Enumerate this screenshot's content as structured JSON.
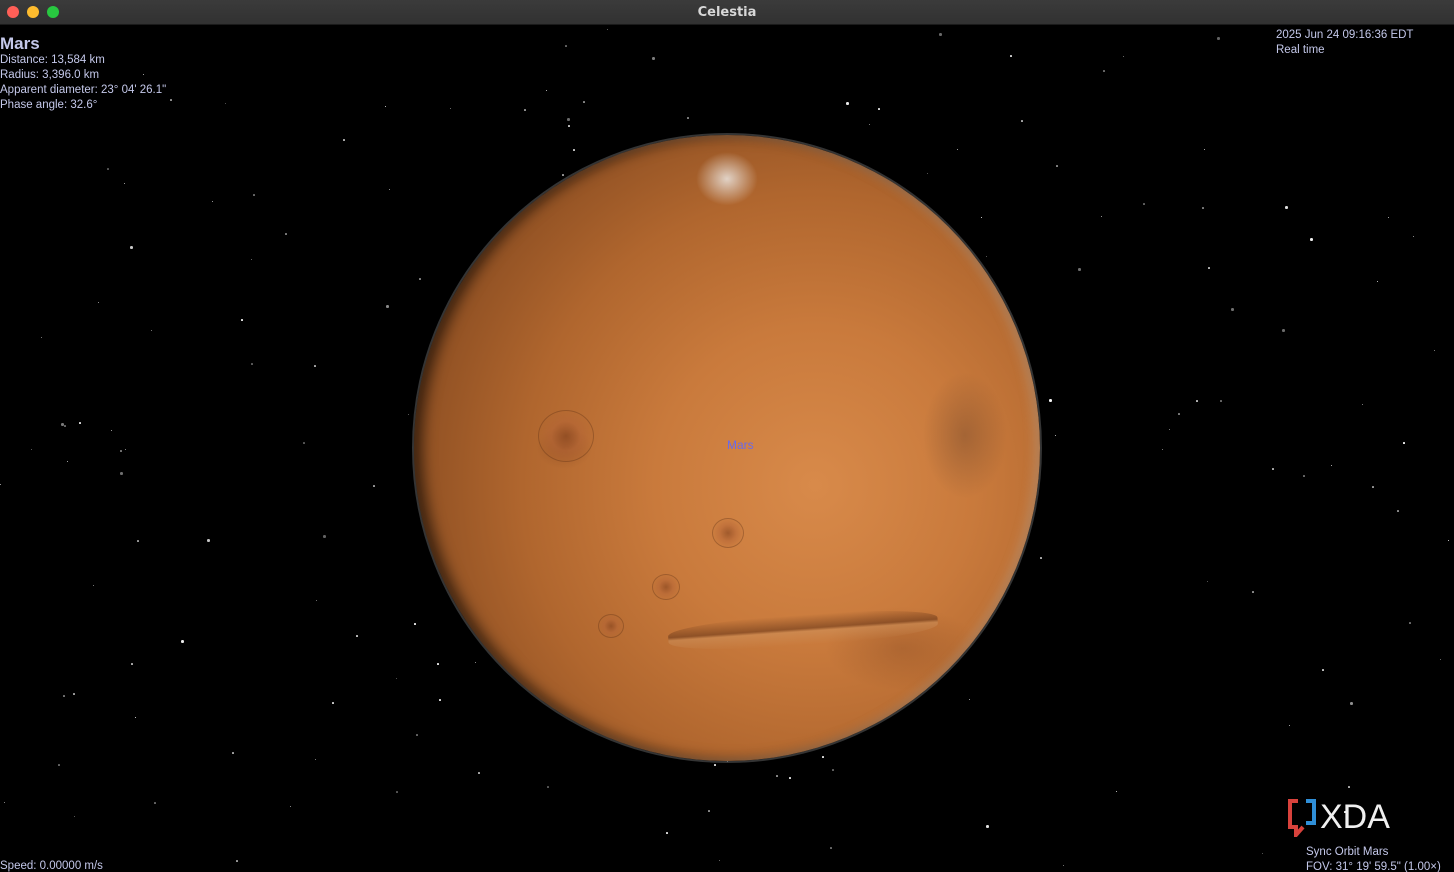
{
  "window": {
    "title": "Celestia"
  },
  "object_info": {
    "name": "Mars",
    "distance": "Distance: 13,584 km",
    "radius": "Radius: 3,396.0 km",
    "apparent_diameter": "Apparent diameter: 23° 04' 26.1\"",
    "phase_angle": "Phase angle: 32.6°"
  },
  "time_info": {
    "datetime": "2025 Jun 24 09:16:36 EDT",
    "rate": "Real time"
  },
  "planet_label": "Mars",
  "speed": "Speed: 0.00000 m/s",
  "view_info": {
    "mode": "Sync Orbit Mars",
    "fov": "FOV: 31° 19' 59.5\" (1.00×)"
  },
  "watermark": {
    "text": "XDA",
    "bracket_colors": [
      "#d8423c",
      "#2f8fd8"
    ],
    "text_color": "#f0f0f0"
  },
  "icons": {
    "close": "close-traffic-light-icon",
    "minimize": "minimize-traffic-light-icon",
    "maximize": "maximize-traffic-light-icon"
  }
}
